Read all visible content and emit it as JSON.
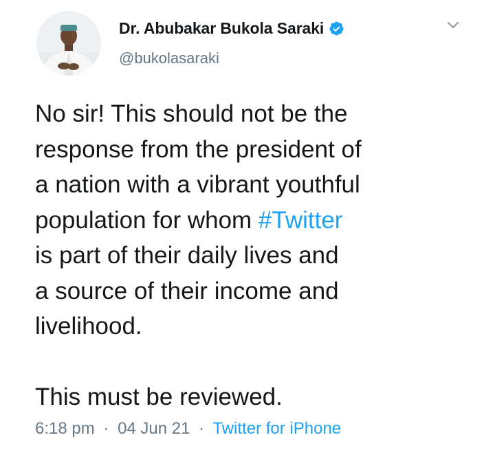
{
  "author": {
    "display_name": "Dr. Abubakar Bukola Saraki",
    "handle": "@bukolasaraki",
    "verified": true,
    "avatar_icon": "profile-photo"
  },
  "tweet": {
    "lines": [
      "No sir! This should not be the",
      "response from the president of",
      "a nation with a vibrant youthful",
      "population for whom ",
      "is part of their daily lives and",
      "a source of their income and",
      "livelihood."
    ],
    "hashtag": "#Twitter",
    "closing": "This must be reviewed."
  },
  "meta": {
    "time": "6:18 pm",
    "separator": "·",
    "date": "04 Jun 21",
    "source": "Twitter for iPhone"
  },
  "colors": {
    "text": "#14171a",
    "secondary": "#657786",
    "link": "#1da1f2",
    "verified": "#1da1f2"
  },
  "icons": {
    "menu": "chevron-down-icon",
    "verified": "verified-badge-icon"
  }
}
